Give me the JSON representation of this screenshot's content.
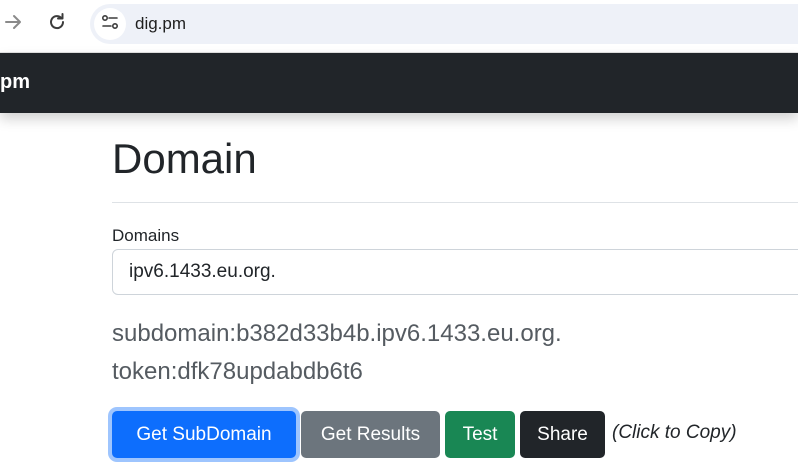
{
  "browser": {
    "url": "dig.pm",
    "icons": [
      "arrow-forward-icon",
      "reload-icon",
      "site-settings-icon"
    ]
  },
  "navbar": {
    "brand": "pm"
  },
  "main": {
    "title": "Domain",
    "domains_label": "Domains",
    "domain_value": "ipv6.1433.eu.org.",
    "subdomain_line": "subdomain:b382d33b4b.ipv6.1433.eu.org.",
    "token_line": "token:dfk78updabdb6t6"
  },
  "buttons": {
    "get_subdomain": "Get SubDomain",
    "get_results": "Get Results",
    "test": "Test",
    "share": "Share"
  },
  "hint": "(Click to Copy)",
  "colors": {
    "primary": "#0d6efd",
    "secondary": "#6c757d",
    "success": "#198754",
    "dark": "#212529"
  }
}
